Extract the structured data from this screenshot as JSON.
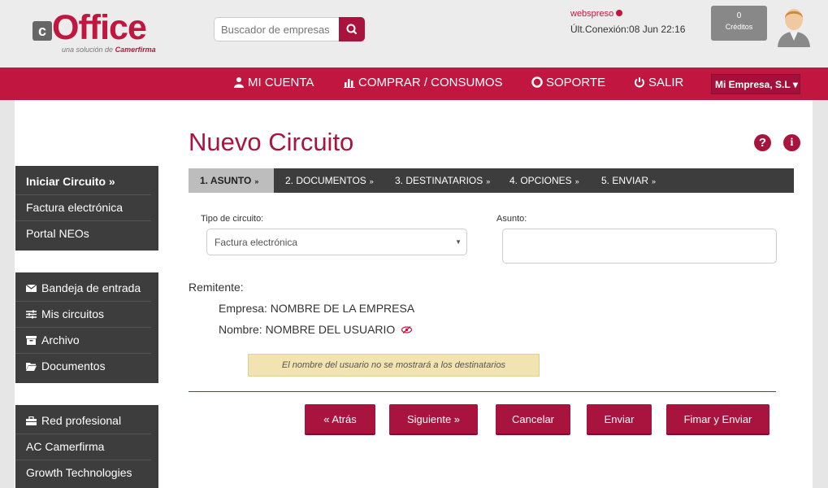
{
  "brand": {
    "box_letter": "c",
    "word": "Office",
    "tagline_prefix": "una solución de",
    "tagline_brand": "Camerfirma"
  },
  "search": {
    "placeholder": "Buscador de empresas"
  },
  "user": {
    "name": "webspreso",
    "last_connection": "Últ.Conexión:08 Jun 22:16"
  },
  "credits": {
    "count": "0",
    "label": "Créditos"
  },
  "nav": {
    "items": [
      {
        "label": "MI CUENTA",
        "icon": "user-icon"
      },
      {
        "label": "COMPRAR / CONSUMOS",
        "icon": "bar-chart-icon"
      },
      {
        "label": "SOPORTE",
        "icon": "lifebuoy-icon"
      },
      {
        "label": "SALIR",
        "icon": "power-icon"
      }
    ],
    "company": "Mi Empresa, S.L ▾"
  },
  "sidebar": {
    "group1": [
      {
        "label": "Iniciar Circuito »"
      },
      {
        "label": "Factura electrónica"
      },
      {
        "label": "Portal NEOs"
      }
    ],
    "group2": [
      {
        "label": "Bandeja de entrada",
        "icon": "envelope-icon"
      },
      {
        "label": "Mis circuitos",
        "icon": "sliders-icon"
      },
      {
        "label": "Archivo",
        "icon": "archive-icon"
      },
      {
        "label": "Documentos",
        "icon": "folder-icon"
      }
    ],
    "group3": [
      {
        "label": "Red profesional",
        "icon": "briefcase-icon"
      },
      {
        "label": "AC Camerfirma"
      },
      {
        "label": "Growth Technologies"
      }
    ]
  },
  "page": {
    "title": "Nuevo Circuito"
  },
  "steps": [
    "1. ASUNTO",
    "2. DOCUMENTOS",
    "3. DESTINATARIOS",
    "4. OPCIONES",
    "5. ENVIAR"
  ],
  "form": {
    "type_label": "Tipo de circuito:",
    "type_value": "Factura electrónica",
    "subject_label": "Asunto:",
    "subject_value": ""
  },
  "sender": {
    "heading": "Remitente:",
    "company": "Empresa: NOMBRE DE LA EMPRESA",
    "name": "Nombre: NOMBRE DEL USUARIO"
  },
  "notice": "El nombre del usuario no se mostrará a los destinatarios",
  "buttons": {
    "back": "« Atrás",
    "next": "Siguiente »",
    "cancel": "Cancelar",
    "send": "Enviar",
    "sign_send": "Fimar y Enviar"
  },
  "colors": {
    "brand": "#c0163f",
    "brand_dark": "#a8143d",
    "sidebar": "#3d3d3d"
  }
}
